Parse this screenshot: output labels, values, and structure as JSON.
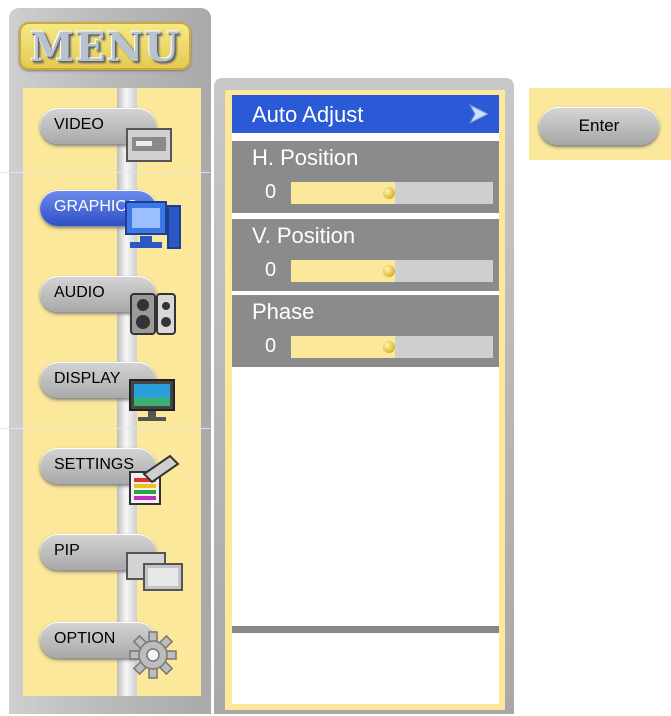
{
  "menu": {
    "title": "MENU",
    "items": [
      {
        "label": "VIDEO",
        "icon": "video-panel-icon",
        "active": false
      },
      {
        "label": "GRAPHICS",
        "icon": "computer-monitor-icon",
        "active": true
      },
      {
        "label": "AUDIO",
        "icon": "speaker-icon",
        "active": false
      },
      {
        "label": "DISPLAY",
        "icon": "display-monitor-icon",
        "active": false
      },
      {
        "label": "SETTINGS",
        "icon": "settings-palette-icon",
        "active": false
      },
      {
        "label": "PIP",
        "icon": "picture-in-picture-icon",
        "active": false
      },
      {
        "label": "OPTION",
        "icon": "gear-icon",
        "active": false
      }
    ]
  },
  "content": {
    "header": {
      "label": "Auto Adjust",
      "icon": "play-arrow-icon"
    },
    "sliders": [
      {
        "label": "H. Position",
        "value": "0",
        "level": 0.5
      },
      {
        "label": "V. Position",
        "value": "0",
        "level": 0.5
      },
      {
        "label": "Phase",
        "value": "0",
        "level": 0.5
      }
    ]
  },
  "enter": {
    "label": "Enter"
  },
  "colors": {
    "accent_yellow": "#fbe89a",
    "selected_blue": "#2a5ad6",
    "panel_gray": "#8b8b8b"
  }
}
